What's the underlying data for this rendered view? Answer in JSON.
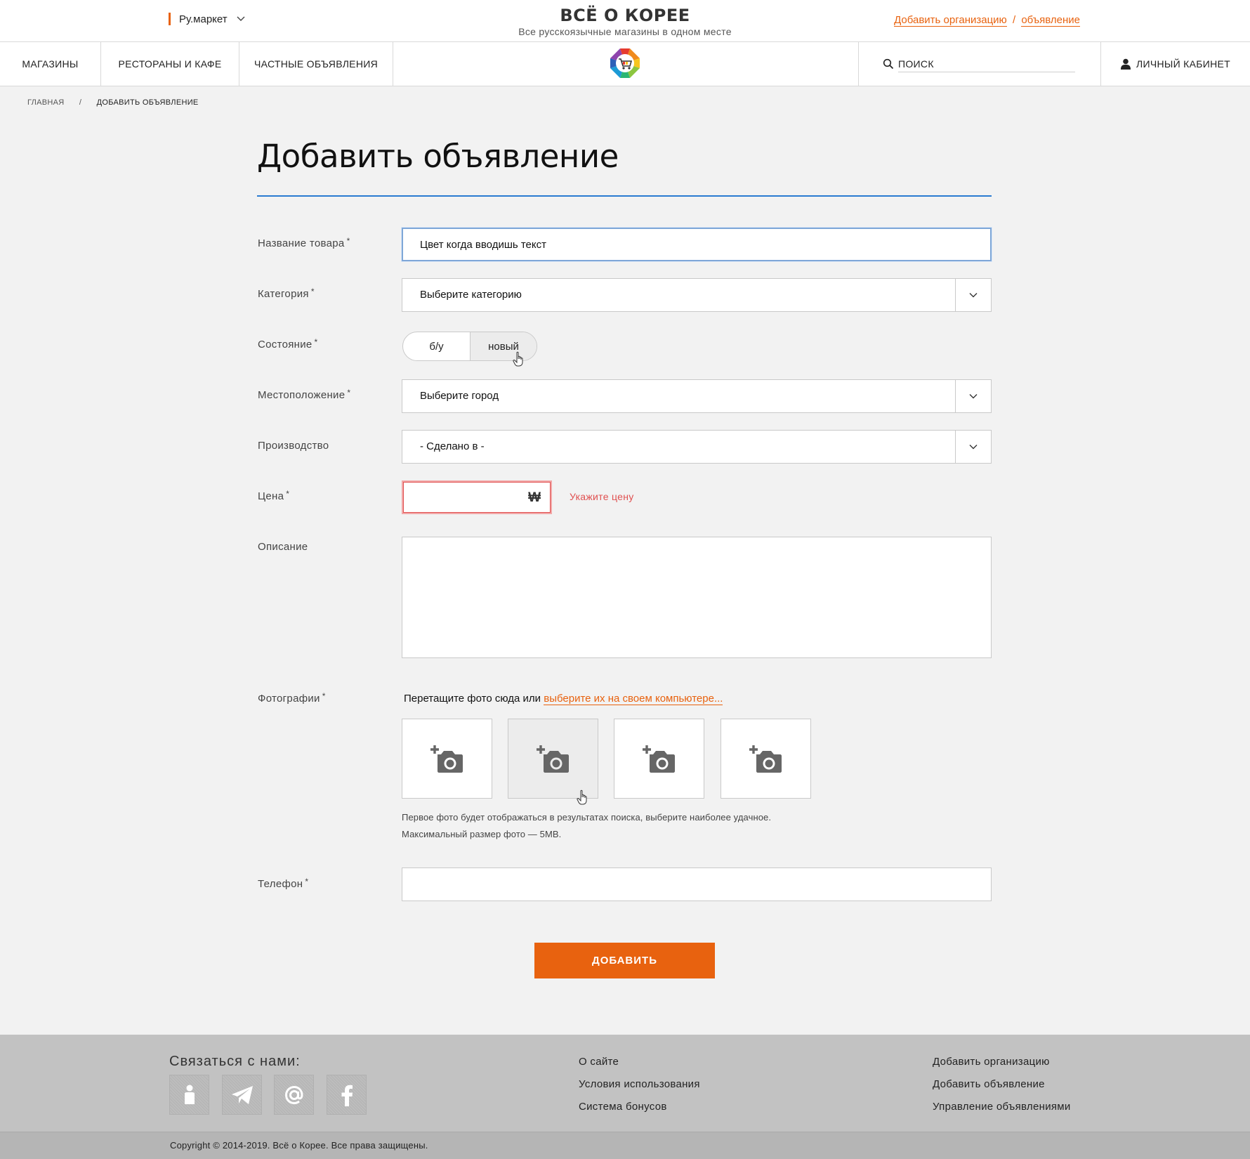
{
  "header": {
    "region": "Ру.маркет",
    "title": "ВСЁ О КОРЕЕ",
    "subtitle": "Все русскоязычные магазины в одном месте",
    "add_org": "Добавить организацию",
    "add_sep": "/",
    "add_ad": "объявление"
  },
  "nav": {
    "items": [
      "МАГАЗИНЫ",
      "РЕСТОРАНЫ И КАФЕ",
      "ЧАСТНЫЕ ОБЪЯВЛЕНИЯ"
    ],
    "search_placeholder": "ПОИСК",
    "cabinet": "ЛИЧНЫЙ КАБИНЕТ"
  },
  "breadcrumb": {
    "home": "ГЛАВНАЯ",
    "sep": "/",
    "current": "ДОБАВИТЬ ОБЪЯВЛЕНИЕ"
  },
  "form": {
    "title": "Добавить объявление",
    "required_mark": "*",
    "name_label": "Название товара",
    "name_value": "Цвет когда вводишь текст",
    "category_label": "Категория",
    "category_value": "Выберите категорию",
    "condition_label": "Состояние",
    "condition_options": [
      "б/у",
      "новый"
    ],
    "condition_selected": "новый",
    "location_label": "Местоположение",
    "location_value": "Выберите город",
    "production_label": "Производство",
    "production_value": "- Сделано в -",
    "price_label": "Цена",
    "price_currency": "₩",
    "price_error": "Укажите цену",
    "description_label": "Описание",
    "photos_label": "Фотографии",
    "photos_drop_text": "Перетащите фото сюда или",
    "photos_link": "выберите их на своем компьютере...",
    "photos_note_1": "Первое фото будет отображаться в результатах поиска, выберите наиболее удачное.",
    "photos_note_2": "Максимальный размер фото — 5MB.",
    "phone_label": "Телефон",
    "submit": "ДОБАВИТЬ"
  },
  "footer": {
    "contact_title": "Связаться с нами:",
    "social_icons": [
      "info-person-icon",
      "telegram-icon",
      "email-at-icon",
      "facebook-icon"
    ],
    "links_col1": [
      "О сайте",
      "Условия использования",
      "Система бонусов"
    ],
    "links_col2": [
      "Добавить организацию",
      "Добавить объявление",
      "Управление объявлениями"
    ],
    "copyright": "Copyright © 2014-2019. Всё о Корее. Все права защищены."
  },
  "colors": {
    "accent": "#e8620f",
    "focus_border": "#7fa7d8",
    "title_rule": "#2a7bd1",
    "error": "#e05050",
    "footer_bg": "#c2c2c2"
  }
}
